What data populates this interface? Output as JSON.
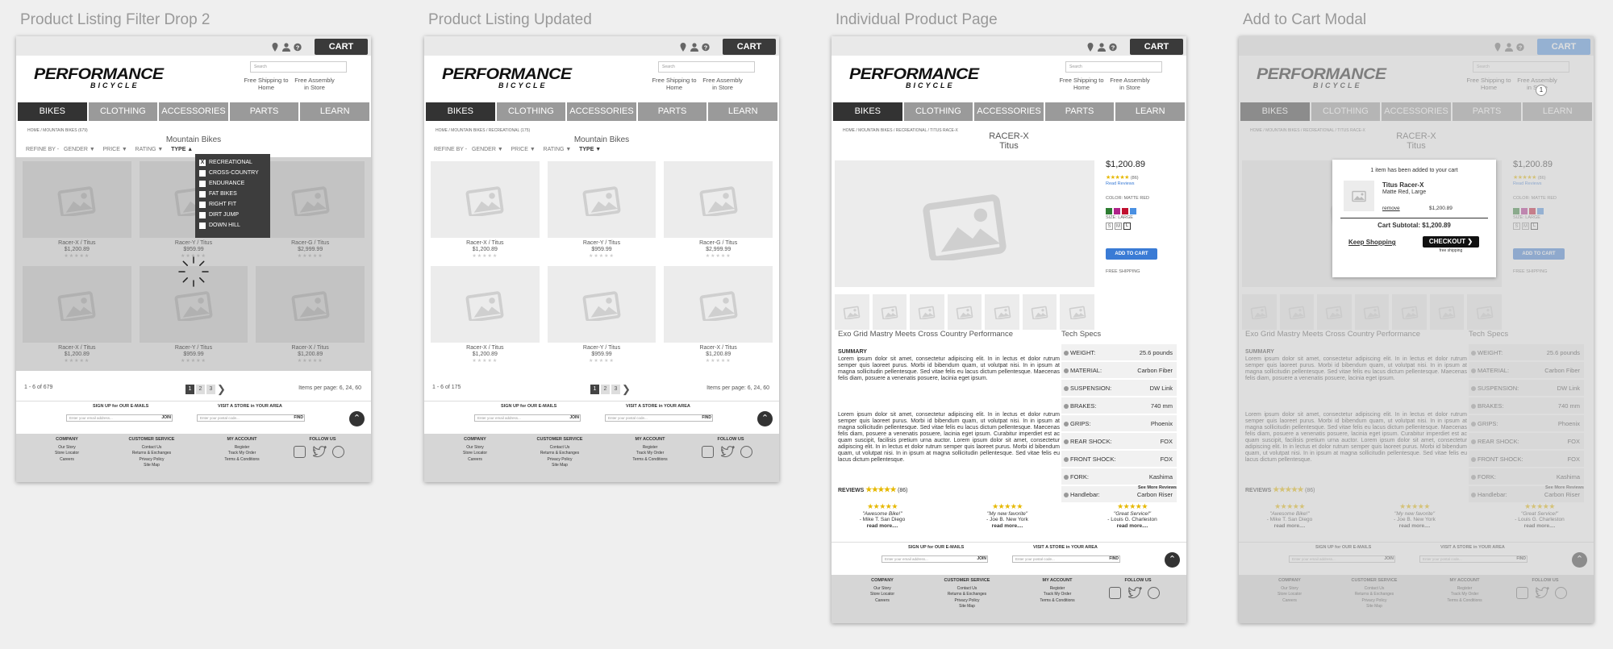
{
  "wireframes": [
    {
      "title": "Product Listing Filter Drop 2"
    },
    {
      "title": "Product Listing Updated"
    },
    {
      "title": "Individual Product Page"
    },
    {
      "title": "Add to Cart Modal"
    }
  ],
  "header": {
    "cart_label": "CART",
    "logo_main": "PERFORMANCE",
    "logo_sub": "BICYCLE",
    "search_placeholder": "Search",
    "free_shipping": "Free Shipping to Home",
    "free_assembly": "Free Assembly in Store",
    "cart_badge": "1"
  },
  "nav": [
    "BIKES",
    "CLOTHING",
    "ACCESSORIES",
    "PARTS",
    "LEARN"
  ],
  "listing": {
    "crumb_1": "HOME / MOUNTAIN BIKES (679)",
    "crumb_2": "HOME / MOUNTAIN BIKES / RECREATIONAL (175)",
    "title": "Mountain Bikes",
    "refine_label": "REFINE BY -",
    "filters": [
      "GENDER ▼",
      "PRICE ▼",
      "RATING ▼"
    ],
    "type_filter_open": "TYPE ▲",
    "type_filter": "TYPE ▼",
    "type_options": [
      "RECREATIONAL",
      "CROSS-COUNTRY",
      "ENDURANCE",
      "FAT BIKES",
      "RIGHT FIT",
      "DIRT JUMP",
      "DOWN HILL"
    ],
    "checked_mark": "X",
    "products": [
      {
        "name": "Racer-X / Titus",
        "price": "$1,200.89"
      },
      {
        "name": "Racer-Y / Titus",
        "price": "$959.99"
      },
      {
        "name": "Racer-G / Titus",
        "price": "$2,999.99"
      },
      {
        "name": "Racer-X / Titus",
        "price": "$1,200.89"
      },
      {
        "name": "Racer-Y / Titus",
        "price": "$959.99"
      },
      {
        "name": "Racer-X / Titus",
        "price": "$1,200.89"
      }
    ],
    "stars": "★★★★★",
    "count_1": "1 - 6 of 679",
    "count_2": "1 - 6 of 175",
    "pages": [
      "1",
      "2",
      "3"
    ],
    "next": "❯",
    "items_per_page": "Items per page: 6, 24, 60"
  },
  "signup": {
    "email_label": "SIGN UP for OUR E-MAILS",
    "email_placeholder": "Enter your email address...",
    "join": "JOIN",
    "store_label": "VISIT A STORE in YOUR AREA",
    "zip_placeholder": "Enter your postal code...",
    "find": "FIND",
    "up": "⌃"
  },
  "footer": {
    "company": {
      "title": "COMPANY",
      "links": [
        "Our Story",
        "Store Locator",
        "Careers"
      ]
    },
    "service": {
      "title": "CUSTOMER SERVICE",
      "links": [
        "Contact Us",
        "Returns & Exchanges",
        "Privacy Policy",
        "Site Map"
      ]
    },
    "account": {
      "title": "MY ACCOUNT",
      "links": [
        "Register",
        "Track My Order",
        "Terms & Conditions"
      ]
    },
    "follow": {
      "title": "FOLLOW US"
    }
  },
  "product": {
    "crumb": "HOME / MOUNTAIN BIKES / RECREATIONAL / TITUS RACE-X",
    "name": "RACER-X",
    "brand": "Titus",
    "price": "$1,200.89",
    "rating_count": "(86)",
    "read_reviews": "Read Reviews",
    "color_label": "COLOR: MATTE RED",
    "colors": [
      "#2e7d32",
      "#b0238a",
      "#c0102f",
      "#4a90e2"
    ],
    "size_label": "SIZE: LARGE",
    "sizes": [
      "S",
      "M",
      "L"
    ],
    "add_to_cart": "ADD TO CART",
    "free_shipping": "FREE SHIPPING",
    "headline": "Exo Grid Mastry Meets Cross Country Performance",
    "summary_label": "SUMMARY",
    "summary": "Lorem ipsum dolor sit amet, consectetur adipiscing elit. In in lectus et dolor rutrum semper quis laoreet purus. Morbi id bibendum quam, ut volutpat nisi. In in ipsum at magna sollicitudin pellentesque. Sed vitae felis eu lacus dictum pellentesque. Maecenas felis diam, posuere a venenatis posuere, lacinia eget ipsum.",
    "body": "Lorem ipsum dolor sit amet, consectetur adipiscing elit. In in lectus et dolor rutrum semper quis laoreet purus. Morbi id bibendum quam, ut volutpat nisi. In in ipsum at magna sollicitudin pellentesque. Sed vitae felis eu lacus dictum pellentesque. Maecenas felis diam, posuere a venenatis posuere, lacinia eget ipsum. Curabitur imperdiet est ac quam suscipit, facilisis pretium urna auctor. Lorem ipsum dolor sit amet, consectetur adipiscing elit. In in lectus et dolor rutrum semper quis laoreet purus. Morbi id bibendum quam, ut volutpat nisi. In in ipsum at magna sollicitudin pellentesque. Sed vitae felis eu lacus dictum pellentesque.",
    "tech_title": "Tech Specs",
    "specs": [
      {
        "k": "WEIGHT:",
        "v": "25.6 pounds"
      },
      {
        "k": "MATERIAL:",
        "v": "Carbon Fiber"
      },
      {
        "k": "SUSPENSION:",
        "v": "DW Link"
      },
      {
        "k": "BRAKES:",
        "v": "740 mm"
      },
      {
        "k": "GRIPS:",
        "v": "Phoenix"
      },
      {
        "k": "REAR SHOCK:",
        "v": "FOX"
      },
      {
        "k": "FRONT SHOCK:",
        "v": "FOX"
      },
      {
        "k": "FORK:",
        "v": "Kashima"
      },
      {
        "k": "Handlebar:",
        "v": "Carbon Riser"
      }
    ],
    "reviews_label": "REVIEWS",
    "reviews_count": "(86)",
    "see_more": "See More Reviews",
    "reviews": [
      {
        "q": "\"Awesome Bike!\"",
        "a": "- Mike T. San Diego"
      },
      {
        "q": "\"My new favorite\"",
        "a": "- Joe B. New York"
      },
      {
        "q": "\"Great Service!\"",
        "a": "- Louis G. Charleston"
      }
    ],
    "read_more": "read more...."
  },
  "modal": {
    "added": "1 item has been added to your cart",
    "name": "Titus Racer-X",
    "variant": "Matte Red, Large",
    "remove": "remove",
    "price": "$1,200.89",
    "subtotal": "Cart Subtotal: $1,200.89",
    "keep": "Keep Shopping",
    "checkout": "CHECKOUT ❯",
    "free_shipping": "free shipping"
  }
}
